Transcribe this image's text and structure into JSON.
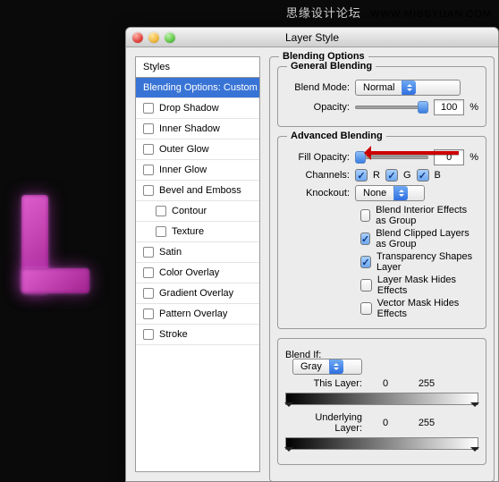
{
  "watermark": {
    "cn": "思缘设计论坛",
    "en": "WWW.MISSYUAN.COM"
  },
  "dialog": {
    "title": "Layer Style"
  },
  "styles": {
    "header": "Styles",
    "items": [
      {
        "label": "Blending Options: Custom",
        "selected": true,
        "checkbox": false
      },
      {
        "label": "Drop Shadow",
        "checkbox": true,
        "checked": false
      },
      {
        "label": "Inner Shadow",
        "checkbox": true,
        "checked": false
      },
      {
        "label": "Outer Glow",
        "checkbox": true,
        "checked": false
      },
      {
        "label": "Inner Glow",
        "checkbox": true,
        "checked": false
      },
      {
        "label": "Bevel and Emboss",
        "checkbox": true,
        "checked": false
      },
      {
        "label": "Contour",
        "checkbox": true,
        "checked": false,
        "indent": true
      },
      {
        "label": "Texture",
        "checkbox": true,
        "checked": false,
        "indent": true
      },
      {
        "label": "Satin",
        "checkbox": true,
        "checked": false
      },
      {
        "label": "Color Overlay",
        "checkbox": true,
        "checked": false
      },
      {
        "label": "Gradient Overlay",
        "checkbox": true,
        "checked": false
      },
      {
        "label": "Pattern Overlay",
        "checkbox": true,
        "checked": false
      },
      {
        "label": "Stroke",
        "checkbox": true,
        "checked": false
      }
    ]
  },
  "blending": {
    "section_title": "Blending Options",
    "general": {
      "title": "General Blending",
      "mode_label": "Blend Mode:",
      "mode_value": "Normal",
      "opacity_label": "Opacity:",
      "opacity_value": "100",
      "pct": "%"
    },
    "advanced": {
      "title": "Advanced Blending",
      "fill_label": "Fill Opacity:",
      "fill_value": "0",
      "pct": "%",
      "channels_label": "Channels:",
      "ch_r": "R",
      "ch_g": "G",
      "ch_b": "B",
      "knockout_label": "Knockout:",
      "knockout_value": "None",
      "opts": [
        {
          "label": "Blend Interior Effects as Group",
          "checked": false
        },
        {
          "label": "Blend Clipped Layers as Group",
          "checked": true
        },
        {
          "label": "Transparency Shapes Layer",
          "checked": true
        },
        {
          "label": "Layer Mask Hides Effects",
          "checked": false
        },
        {
          "label": "Vector Mask Hides Effects",
          "checked": false
        }
      ]
    },
    "blendif": {
      "title": "Blend If:",
      "channel": "Gray",
      "this_label": "This Layer:",
      "this_lo": "0",
      "this_hi": "255",
      "under_label": "Underlying Layer:",
      "under_lo": "0",
      "under_hi": "255"
    }
  }
}
